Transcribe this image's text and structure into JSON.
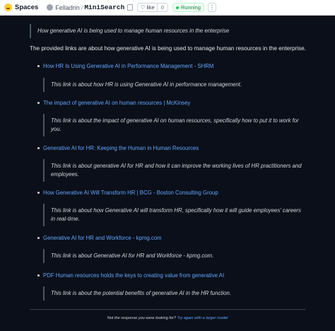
{
  "topbar": {
    "spaces_label": "Spaces",
    "owner": "Felladrin",
    "separator": "/",
    "repo": "MiniSearch",
    "like_label": "like",
    "like_count": "0",
    "status": "Running",
    "menu_glyph": "⋮"
  },
  "query_quote": "How generative AI is being used to manage human resources in the enterprise",
  "intro": "The provided links are about how generative AI is being used to manage human resources in the enterprise.",
  "results": [
    {
      "title": "How HR Is Using Generative AI in Performance Management - SHRM",
      "description": "This link is about how HR is using Generative AI in performance management."
    },
    {
      "title": "The impact of generative AI on human resources | McKinsey",
      "description": "This link is about the impact of generative AI on human resources, specifically how to put it to work for you."
    },
    {
      "title": "Generative AI for HR: Keeping the Human in Human Resources",
      "description": "This link is about generative AI for HR and how it can improve the working lives of HR practitioners and employees."
    },
    {
      "title": "How Generative AI Will Transform HR | BCG - Boston Consulting Group",
      "description": "This link is about how Generative AI will transform HR, specifically how it will guide employees' careers in real-time."
    },
    {
      "title": "Generative AI for HR and Workforce - kpmg.com",
      "description": "This link is about Generative AI for HR and Workforce - kpmg.com."
    },
    {
      "title": "PDF Human resources holds the keys to creating value from generative AI",
      "description": "This link is about the potential benefits of generative AI in the HR function."
    }
  ],
  "footer": {
    "text": "Not the response you were looking for?",
    "link": "Try again with a larger model"
  },
  "colors": {
    "background": "#0b0f19",
    "link": "#60a5fa",
    "status_green": "#15803d"
  }
}
